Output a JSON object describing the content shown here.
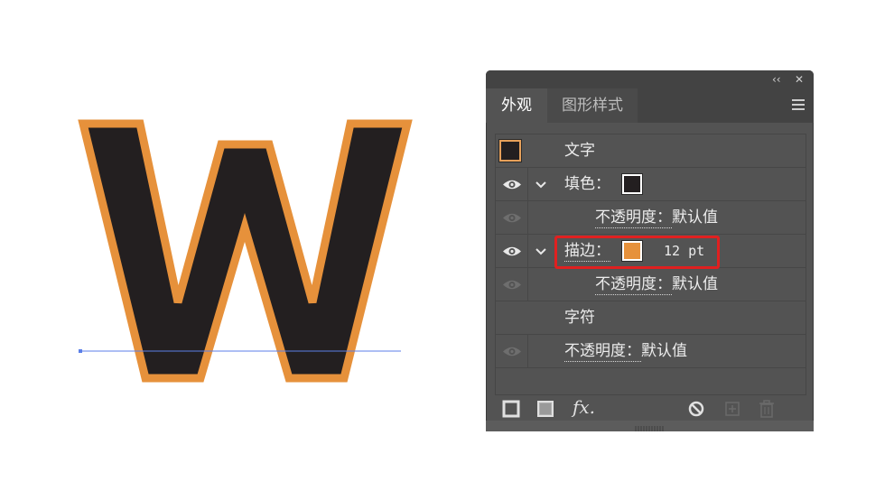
{
  "panel": {
    "collapse_label": "‹‹",
    "close_label": "✕",
    "tabs": [
      {
        "label": "外观"
      },
      {
        "label": "图形样式"
      }
    ],
    "rows": {
      "type_label": "文字",
      "fill_label": "填色：",
      "fill_opacity_label": "不透明度：",
      "fill_opacity_value": "默认值",
      "stroke_label": "描边：",
      "stroke_width": "12 pt",
      "stroke_opacity_label": "不透明度：",
      "stroke_opacity_value": "默认值",
      "characters_label": "字符",
      "opacity_label": "不透明度：",
      "opacity_value": "默认值"
    },
    "bottom_icons": [
      "add-new-stroke-icon",
      "add-new-fill-icon",
      "add-new-effect-icon",
      "clear-appearance-icon",
      "duplicate-item-icon",
      "delete-item-icon"
    ],
    "fx_label": "fx."
  },
  "colors": {
    "fill": "#231f20",
    "stroke": "#e6913b",
    "panel_bg": "#535353",
    "highlight": "#e02020",
    "baseline": "#5b7fe8"
  },
  "artwork": {
    "letter": "W"
  }
}
